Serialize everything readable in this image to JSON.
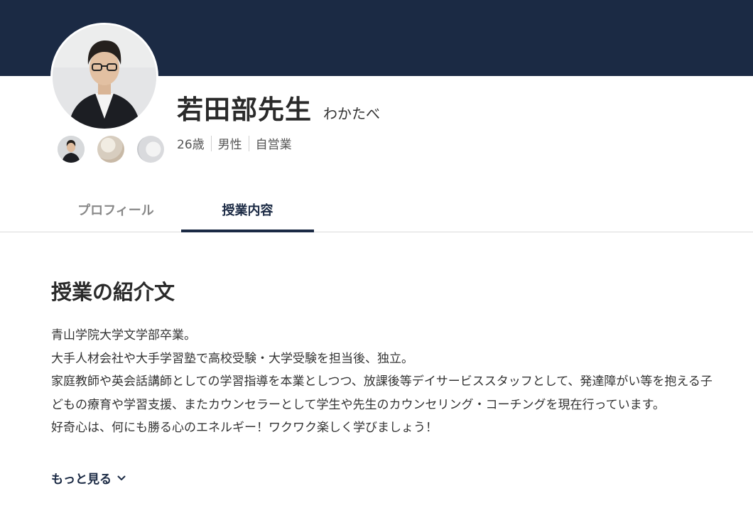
{
  "teacher": {
    "name": "若田部先生",
    "kana": "わかたべ",
    "age": "26歳",
    "gender": "男性",
    "occupation": "自営業"
  },
  "tabs": [
    {
      "label": "プロフィール",
      "active": false
    },
    {
      "label": "授業内容",
      "active": true
    }
  ],
  "section": {
    "title": "授業の紹介文",
    "lines": [
      "青山学院大学文学部卒業。",
      "大手人材会社や大手学習塾で高校受験・大学受験を担当後、独立。",
      "家庭教師や英会話講師としての学習指導を本業としつつ、放課後等デイサービススタッフとして、発達障がい等を抱える子どもの療育や学習支援、またカウンセラーとして学生や先生のカウンセリング・コーチングを現在行っています。",
      "好奇心は、何にも勝る心のエネルギー！ワクワク楽しく学びましょう！"
    ],
    "more_label": "もっと見る"
  },
  "colors": {
    "banner": "#1b2a44",
    "accent": "#1b2a44"
  },
  "icons": {
    "more": "chevron-down-icon"
  }
}
